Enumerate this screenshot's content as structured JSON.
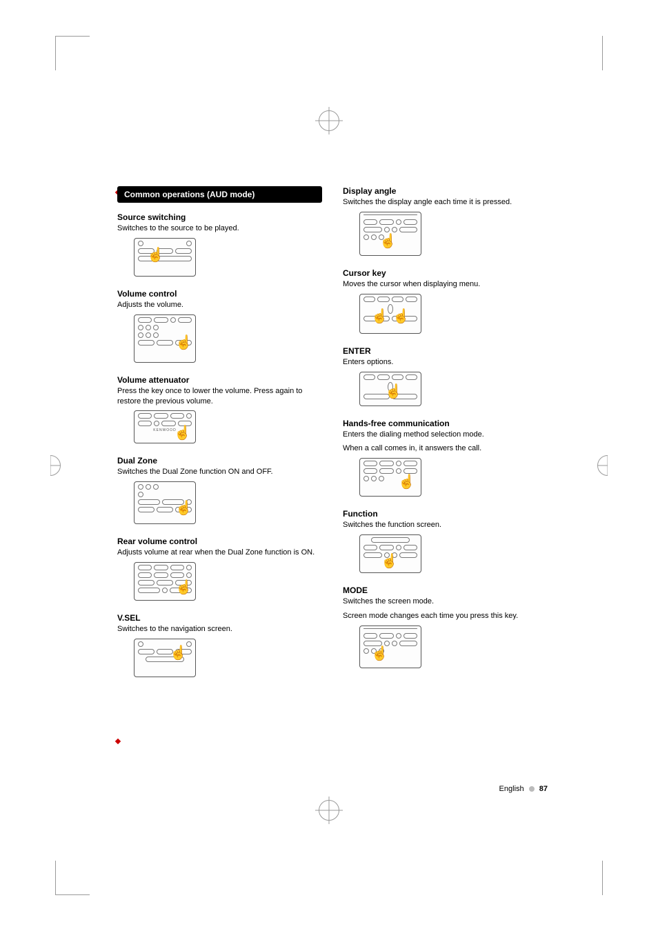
{
  "left": {
    "header": "Common operations (AUD mode)",
    "sections": [
      {
        "title": "Source switching",
        "desc": "Switches to the source to be played."
      },
      {
        "title": "Volume control",
        "desc": "Adjusts the volume."
      },
      {
        "title": "Volume attenuator",
        "desc": "Press the key once to lower the volume. Press again to restore the previous volume."
      },
      {
        "title": "Dual Zone",
        "desc": "Switches the Dual Zone function ON and OFF."
      },
      {
        "title": "Rear volume control",
        "desc": "Adjusts volume at rear when the Dual Zone function is ON."
      },
      {
        "title": "V.SEL",
        "desc": "Switches to the navigation screen."
      }
    ]
  },
  "right": {
    "sections": [
      {
        "title": "Display angle",
        "desc": "Switches the display angle each time it is pressed."
      },
      {
        "title": "Cursor key",
        "desc": "Moves the cursor when displaying menu."
      },
      {
        "title": "ENTER",
        "desc": "Enters options."
      },
      {
        "title": "Hands-free communication",
        "desc": "Enters the dialing method selection mode.",
        "desc2": "When a call comes in, it answers the call."
      },
      {
        "title": "Function",
        "desc": "Switches the function screen."
      },
      {
        "title": "MODE",
        "desc": "Switches the screen mode.",
        "desc2": "Screen mode changes each time you press this key."
      }
    ]
  },
  "footer": {
    "lang": "English",
    "page": "87"
  }
}
